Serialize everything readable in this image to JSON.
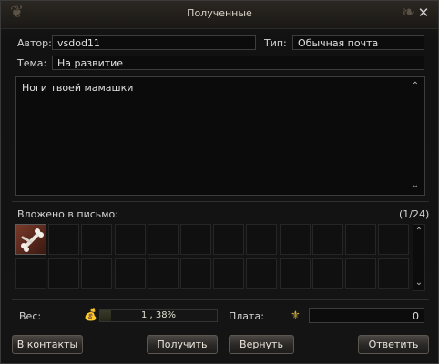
{
  "window": {
    "title": "Полученные"
  },
  "header": {
    "author_label": "Автор:",
    "author_value": "vsdod11",
    "type_label": "Тип:",
    "type_value": "Обычная почта",
    "subject_label": "Тема:",
    "subject_value": "На развитие"
  },
  "message": {
    "body": "Ноги твоей мамашки"
  },
  "attachments": {
    "label": "Вложено в письмо:",
    "count": "(1/24)",
    "slots_total": 24,
    "filled_slots": [
      {
        "index": 0,
        "icon": "bone-item-icon"
      }
    ]
  },
  "footer": {
    "weight_label": "Вес:",
    "weight_value": "1 , 38%",
    "weight_fraction": 0.0138,
    "fee_label": "Плата:",
    "fee_value": "0"
  },
  "buttons": {
    "contacts": "В контакты",
    "receive": "Получить",
    "return": "Вернуть",
    "reply": "Ответить"
  },
  "icons": {
    "close": "close-icon",
    "scroll_up": "scroll-up-icon",
    "scroll_down": "scroll-down-icon",
    "weight": "weight-bag-icon",
    "fee": "coins-icon"
  }
}
